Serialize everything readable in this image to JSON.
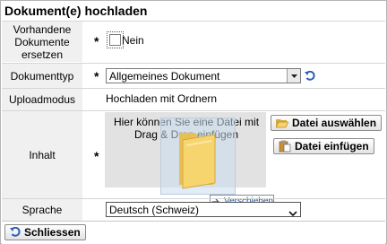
{
  "dialog": {
    "title": "Dokument(e) hochladen"
  },
  "fields": {
    "replace": {
      "label": "Vorhandene\nDokumente\nersetzen",
      "required_mark": "*",
      "checkbox_label": "Nein"
    },
    "doctype": {
      "label": "Dokumenttyp",
      "required_mark": "*",
      "selected": "Allgemeines Dokument"
    },
    "upload_mode": {
      "label": "Uploadmodus",
      "value": "Hochladen mit Ordnern"
    },
    "content": {
      "label": "Inhalt",
      "required_mark": "*",
      "drop_hint": "Hier können Sie eine Datei mit Drag & Drop einfügen",
      "select_file_button": "Datei auswählen",
      "paste_file_button": "Datei einfügen"
    },
    "language": {
      "label": "Sprache",
      "selected": "Deutsch (Schweiz)"
    }
  },
  "drag": {
    "tooltip": "Verschieben"
  },
  "footer": {
    "close_button": "Schliessen"
  },
  "colors": {
    "accent_blue": "#2c5fb4",
    "folder_yellow": "#f5d36b",
    "label_bg": "#f0f0f0"
  }
}
